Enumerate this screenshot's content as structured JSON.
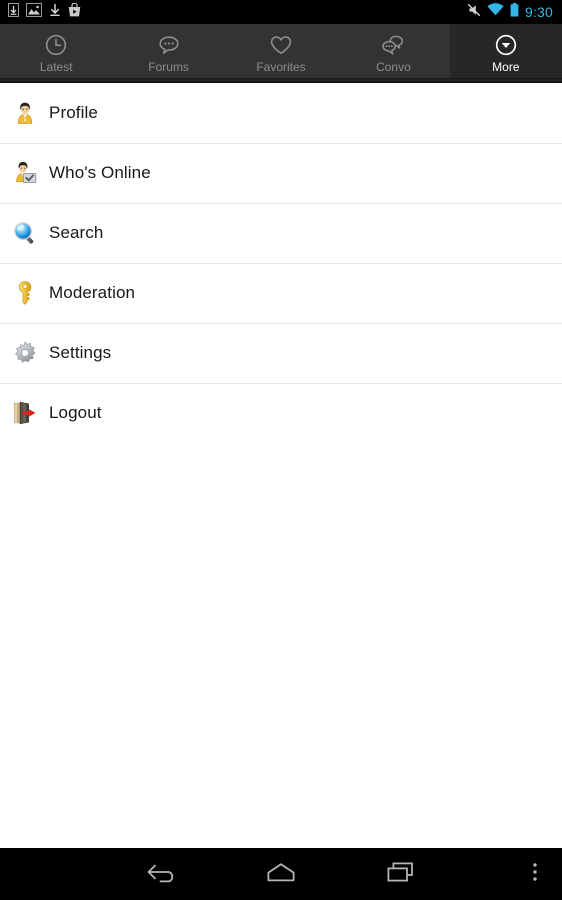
{
  "statusbar": {
    "time": "9:30",
    "time_color": "#33b5e5",
    "left_icons": [
      {
        "name": "save-to-device-icon"
      },
      {
        "name": "image-icon"
      },
      {
        "name": "download-icon"
      },
      {
        "name": "play-store-icon"
      }
    ],
    "right_icons": [
      {
        "name": "mute-icon"
      },
      {
        "name": "wifi-icon"
      },
      {
        "name": "battery-icon"
      }
    ]
  },
  "tabs": [
    {
      "label": "Latest",
      "icon": "clock-icon",
      "active": false
    },
    {
      "label": "Forums",
      "icon": "speech-bubble-icon",
      "active": false
    },
    {
      "label": "Favorites",
      "icon": "heart-icon",
      "active": false
    },
    {
      "label": "Convo",
      "icon": "conversation-icon",
      "active": false
    },
    {
      "label": "More",
      "icon": "chevron-down-circle-icon",
      "active": true
    }
  ],
  "menu": {
    "items": [
      {
        "label": "Profile",
        "icon": "user-icon"
      },
      {
        "label": "Who's Online",
        "icon": "user-online-icon"
      },
      {
        "label": "Search",
        "icon": "magnifier-icon"
      },
      {
        "label": "Moderation",
        "icon": "key-icon"
      },
      {
        "label": "Settings",
        "icon": "gear-icon"
      },
      {
        "label": "Logout",
        "icon": "exit-door-icon"
      }
    ]
  },
  "navbar": {
    "buttons": [
      {
        "name": "back-button",
        "icon": "back-arrow-icon"
      },
      {
        "name": "home-button",
        "icon": "home-icon"
      },
      {
        "name": "recents-button",
        "icon": "recents-icon"
      },
      {
        "name": "overflow-button",
        "icon": "overflow-menu-icon"
      }
    ]
  },
  "colors": {
    "tabbar_bg": "#333333",
    "tab_active_bg": "#272727",
    "tab_inactive_text": "#8e8e8e",
    "tab_active_text": "#ffffff",
    "list_bg": "#ffffff",
    "divider": "#e6e6e6",
    "label_text": "#181818",
    "system_bg": "#000000"
  }
}
